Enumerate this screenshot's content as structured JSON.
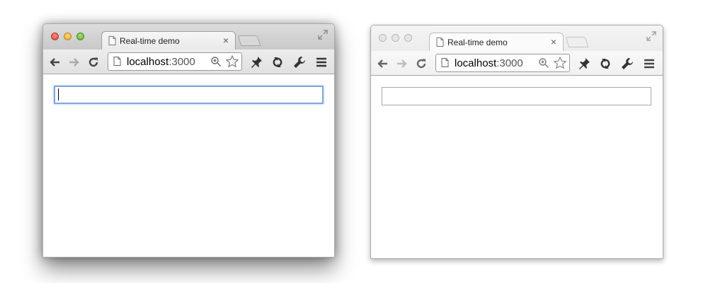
{
  "windows": [
    {
      "state": "focused",
      "tab": {
        "title": "Real-time demo",
        "close_glyph": "×",
        "favicon": "page-icon"
      },
      "address": {
        "host": "localhost",
        "port": ":3000"
      },
      "toolbar_icons": [
        "back-arrow-icon",
        "forward-arrow-icon",
        "reload-icon",
        "zoom-icon",
        "star-icon",
        "pin-icon",
        "sync-icon",
        "wrench-icon",
        "menu-icon"
      ],
      "input": {
        "value": "",
        "focused": true
      }
    },
    {
      "state": "unfocused",
      "tab": {
        "title": "Real-time demo",
        "close_glyph": "×",
        "favicon": "page-icon"
      },
      "address": {
        "host": "localhost",
        "port": ":3000"
      },
      "toolbar_icons": [
        "back-arrow-icon",
        "forward-arrow-icon",
        "reload-icon",
        "zoom-icon",
        "star-icon",
        "pin-icon",
        "sync-icon",
        "wrench-icon",
        "menu-icon"
      ],
      "input": {
        "value": "",
        "focused": false
      }
    }
  ],
  "colors": {
    "focus_ring": "#7fa8de",
    "close_light": "#d8453b",
    "minimize_light": "#dba531",
    "maximize_light": "#5ea935"
  }
}
